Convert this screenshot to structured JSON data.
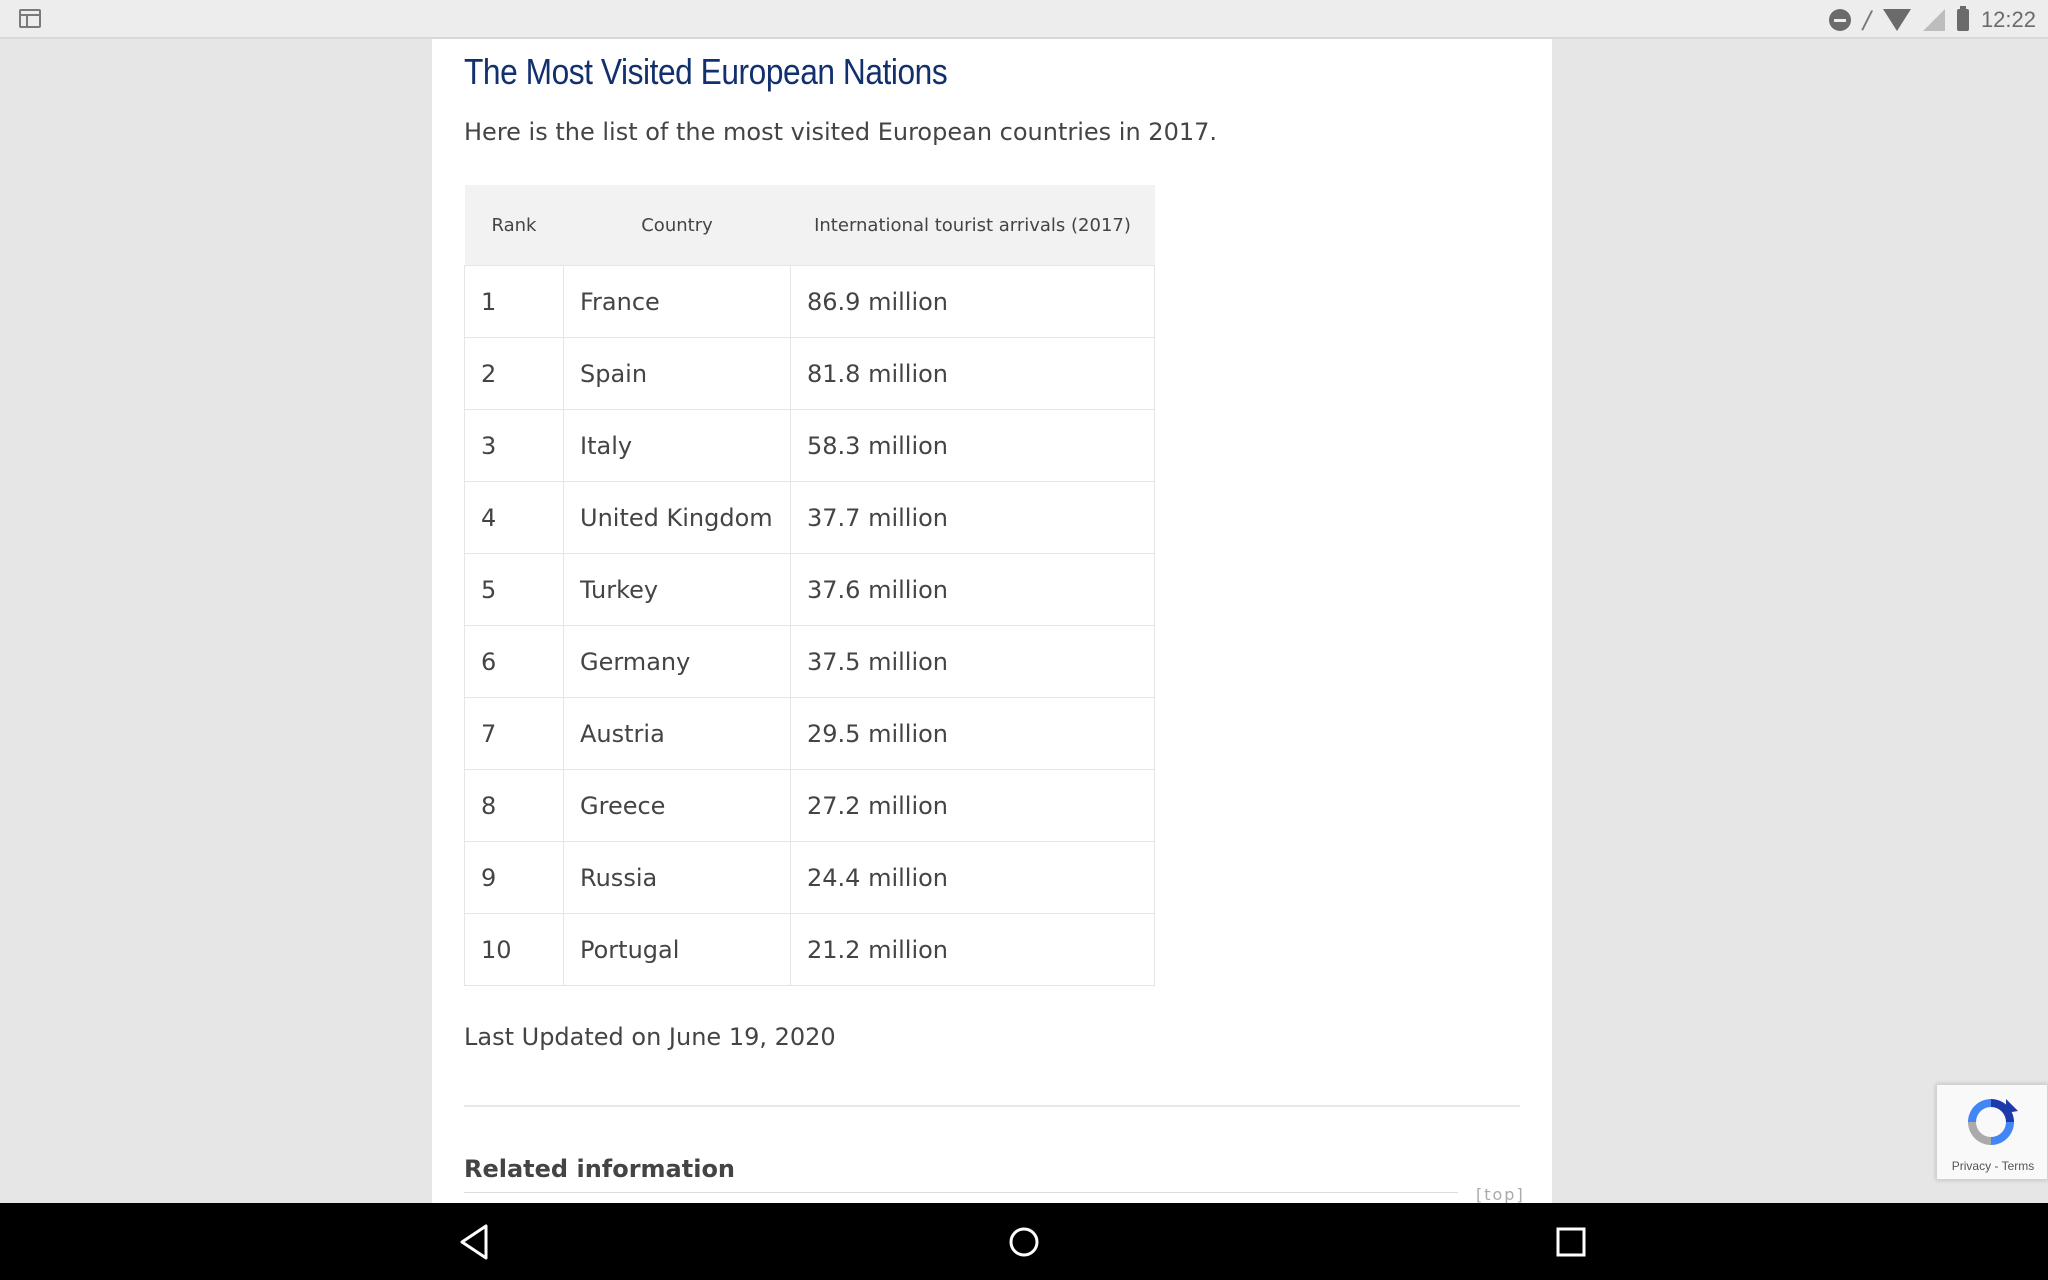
{
  "statusbar": {
    "time": "12:22",
    "icons": [
      "window-icon",
      "do-not-disturb-icon",
      "wifi-icon",
      "signal-icon",
      "battery-charging-icon"
    ]
  },
  "article": {
    "title": "The Most Visited European Nations",
    "intro": "Here is the list of the most visited European countries in 2017.",
    "table": {
      "headers": [
        "Rank",
        "Country",
        "International tourist arrivals (2017)"
      ],
      "rows": [
        [
          "1",
          "France",
          "86.9 million"
        ],
        [
          "2",
          "Spain",
          "81.8 million"
        ],
        [
          "3",
          "Italy",
          "58.3 million"
        ],
        [
          "4",
          "United Kingdom",
          "37.7 million"
        ],
        [
          "5",
          "Turkey",
          "37.6 million"
        ],
        [
          "6",
          "Germany",
          "37.5 million"
        ],
        [
          "7",
          "Austria",
          "29.5 million"
        ],
        [
          "8",
          "Greece",
          "27.2 million"
        ],
        [
          "9",
          "Russia",
          "24.4 million"
        ],
        [
          "10",
          "Portugal",
          "21.2 million"
        ]
      ]
    },
    "last_updated": "Last Updated on June 19, 2020",
    "related_heading": "Related information",
    "top_link": "[top]"
  },
  "recaptcha": {
    "privacy": "Privacy",
    "separator": "-",
    "terms": "Terms"
  },
  "navbar": {
    "icons": [
      "back-icon",
      "home-icon",
      "recents-icon"
    ]
  },
  "colors": {
    "title": "#12306e",
    "text": "#444444",
    "header_bg": "#f2f2f2"
  }
}
